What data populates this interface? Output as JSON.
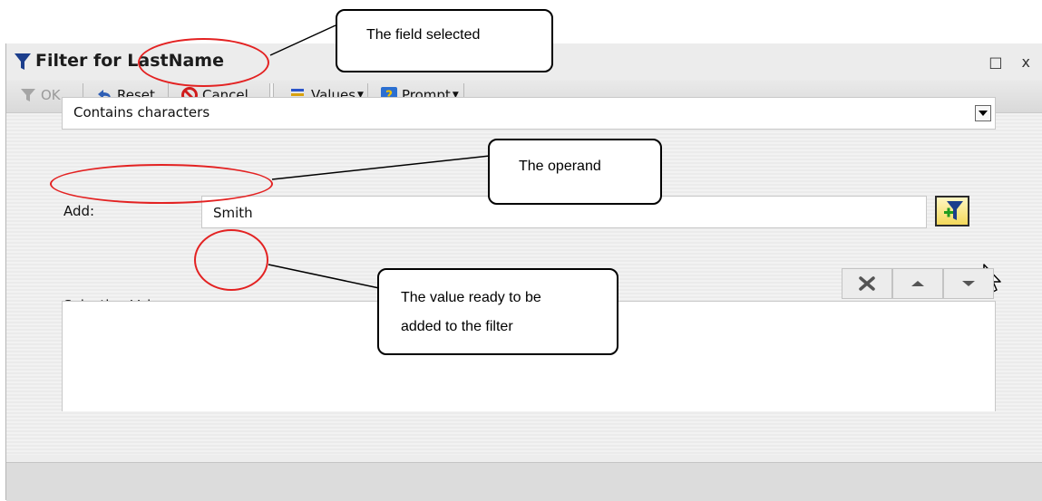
{
  "window": {
    "title": "Filter for LastName",
    "controls": "□ x"
  },
  "toolbar": {
    "ok_label": "OK",
    "reset_label": "Reset",
    "cancel_label": "Cancel",
    "values_label": "Values",
    "prompt_label": "Prompt"
  },
  "operand": {
    "value": "Contains characters"
  },
  "add": {
    "label": "Add:",
    "value": "Smith"
  },
  "selection": {
    "label": "Selection Values:"
  },
  "annotations": {
    "field_selected": "The field selected",
    "operand": "The operand",
    "value_line1": "The value ready to be",
    "value_line2": "added to the filter"
  },
  "colors": {
    "ring": "#e32222",
    "funnel": "#1c3e8c"
  }
}
